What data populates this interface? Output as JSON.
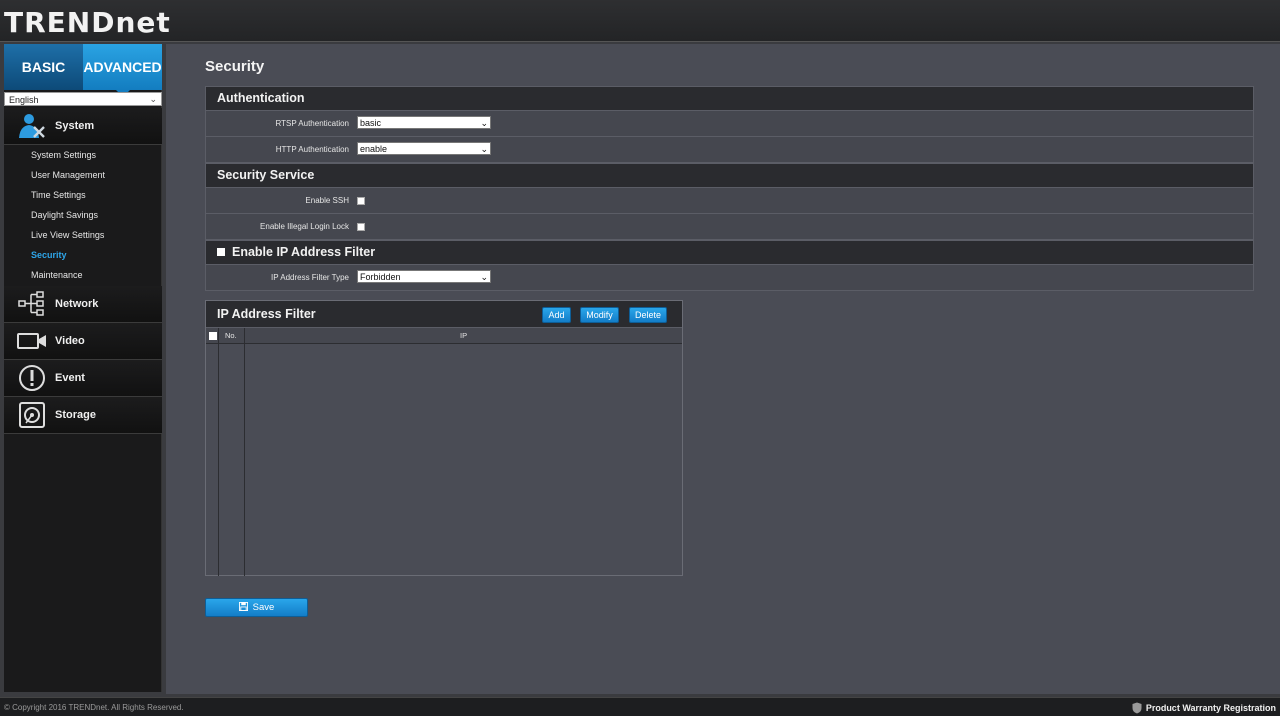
{
  "header": {
    "logo": "TRENDnet"
  },
  "sidebar": {
    "tabs": [
      {
        "label": "BASIC"
      },
      {
        "label": "ADVANCED"
      }
    ],
    "language": "English",
    "categories": [
      {
        "label": "System",
        "icon": "system-user-icon"
      },
      {
        "label": "Network",
        "icon": "network-icon"
      },
      {
        "label": "Video",
        "icon": "video-camera-icon"
      },
      {
        "label": "Event",
        "icon": "alert-icon"
      },
      {
        "label": "Storage",
        "icon": "storage-disk-icon"
      }
    ],
    "system_items": [
      {
        "label": "System Settings"
      },
      {
        "label": "User Management"
      },
      {
        "label": "Time Settings"
      },
      {
        "label": "Daylight Savings"
      },
      {
        "label": "Live View Settings"
      },
      {
        "label": "Security"
      },
      {
        "label": "Maintenance"
      }
    ]
  },
  "page": {
    "title": "Security",
    "authentication": {
      "heading": "Authentication",
      "rtsp_label": "RTSP Authentication",
      "rtsp_value": "basic",
      "http_label": "HTTP Authentication",
      "http_value": "enable"
    },
    "security_service": {
      "heading": "Security Service",
      "ssh_label": "Enable SSH",
      "illegal_login_label": "Enable Illegal Login Lock"
    },
    "ip_filter": {
      "heading": "Enable IP Address Filter",
      "type_label": "IP Address Filter Type",
      "type_value": "Forbidden"
    },
    "ip_table": {
      "title": "IP Address Filter",
      "add": "Add",
      "modify": "Modify",
      "delete": "Delete",
      "col_no": "No.",
      "col_ip": "IP"
    },
    "save": "Save"
  },
  "footer": {
    "copyright": "© Copyright 2016 TRENDnet. All Rights Reserved.",
    "warranty": "Product Warranty Registration"
  },
  "colors": {
    "accent": "#2ea6ea",
    "panel": "#4a4c55",
    "section": "#2a2b2f"
  }
}
